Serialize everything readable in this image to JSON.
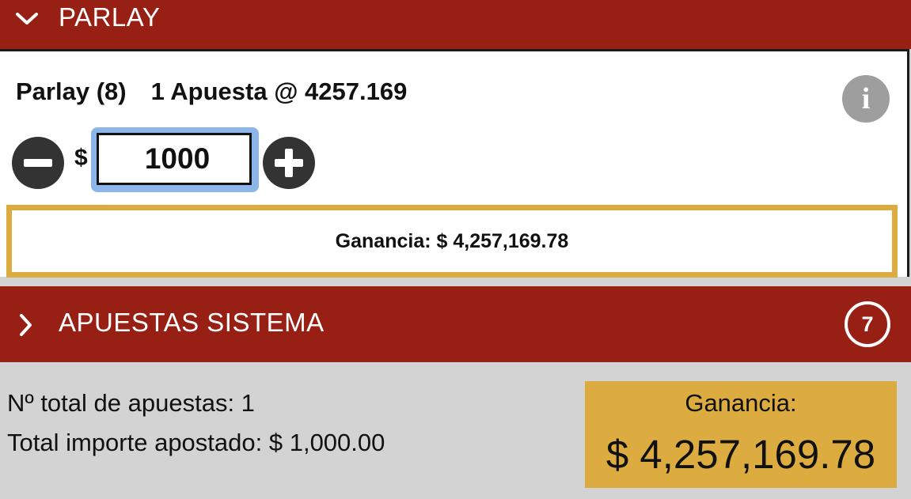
{
  "parlay_header": {
    "title": "PARLAY",
    "chevron_icon": "chevron-down-icon"
  },
  "parlay": {
    "name": "Parlay (8)",
    "bet_line": "1 Apuesta @ 4257.169",
    "info_icon": "info-icon",
    "currency_symbol": "$",
    "stake_value": "1000",
    "winnings_text": "Ganancia: $ 4,257,169.78"
  },
  "system_header": {
    "title": "APUESTAS SISTEMA",
    "count": "7",
    "chevron_icon": "chevron-right-icon"
  },
  "summary": {
    "total_bets": "Nº total de apuestas: 1",
    "total_stake": "Total importe apostado: $ 1,000.00",
    "winnings_label": "Ganancia:",
    "winnings_value": "$ 4,257,169.78"
  },
  "colors": {
    "header_red": "#981f14",
    "gold": "#dcac40",
    "focus_blue": "#8cb6ea",
    "footer_gray": "#d3d3d3"
  }
}
